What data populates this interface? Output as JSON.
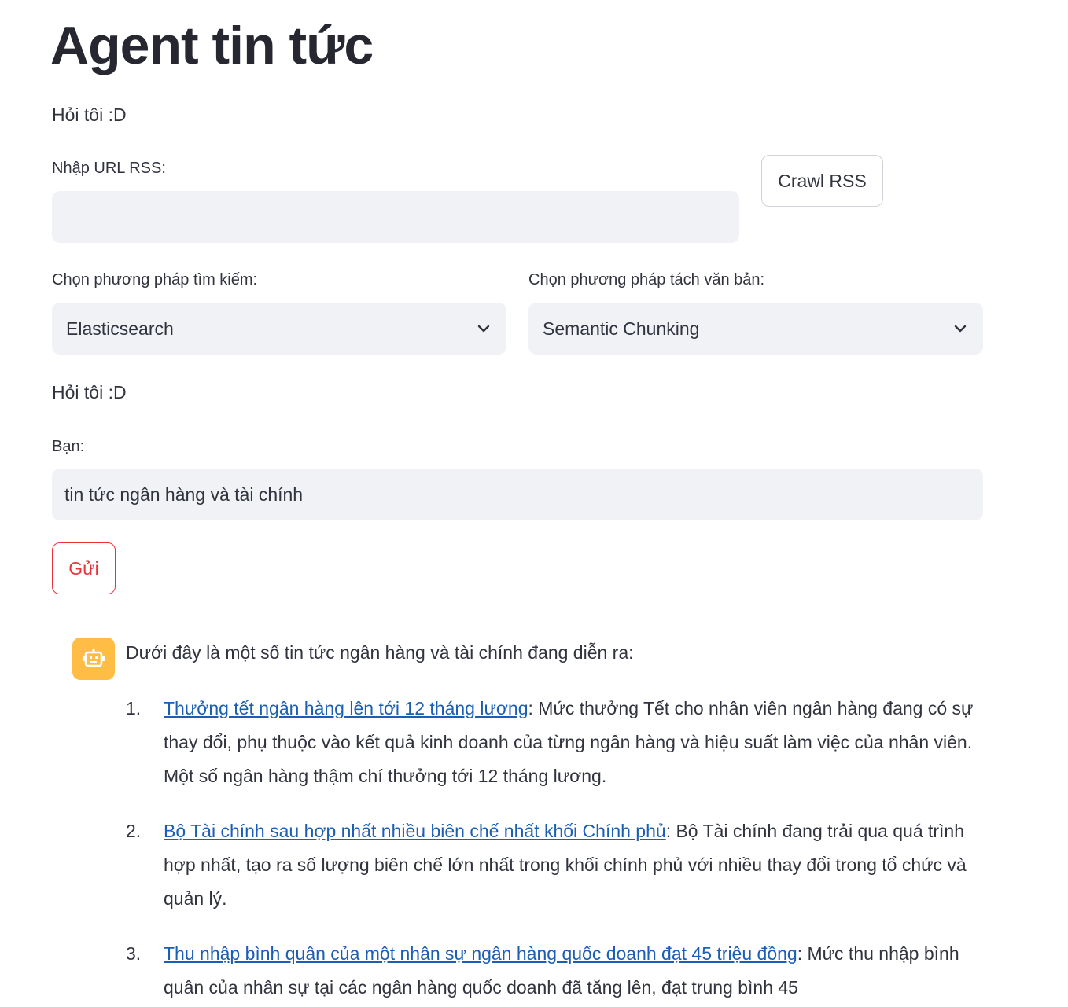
{
  "header": {
    "title": "Agent tin tức",
    "subtitle": "Hỏi tôi :D"
  },
  "rss": {
    "label": "Nhập URL RSS:",
    "value": "",
    "placeholder": "",
    "crawl_button": "Crawl RSS"
  },
  "search_method": {
    "label": "Chọn phương pháp tìm kiếm:",
    "selected": "Elasticsearch"
  },
  "split_method": {
    "label": "Chọn phương pháp tách văn bản:",
    "selected": "Semantic Chunking"
  },
  "chat": {
    "caption": "Hỏi tôi :D",
    "input_label": "Bạn:",
    "input_value": "tin tức ngân hàng và tài chính",
    "send_button": "Gửi"
  },
  "response": {
    "intro": "Dưới đây là một số tin tức ngân hàng và tài chính đang diễn ra:",
    "items": [
      {
        "number": "1.",
        "link": "Thưởng tết ngân hàng lên tới 12 tháng lương",
        "text": ": Mức thưởng Tết cho nhân viên ngân hàng đang có sự thay đổi, phụ thuộc vào kết quả kinh doanh của từng ngân hàng và hiệu suất làm việc của nhân viên. Một số ngân hàng thậm chí thưởng tới 12 tháng lương."
      },
      {
        "number": "2.",
        "link": "Bộ Tài chính sau hợp nhất nhiều biên chế nhất khối Chính phủ",
        "text": ": Bộ Tài chính đang trải qua quá trình hợp nhất, tạo ra số lượng biên chế lớn nhất trong khối chính phủ với nhiều thay đổi trong tổ chức và quản lý."
      },
      {
        "number": "3.",
        "link": "Thu nhập bình quân của một nhân sự ngân hàng quốc doanh đạt 45 triệu đồng",
        "text": ": Mức thu nhập bình quân của nhân sự tại các ngân hàng quốc doanh đã tăng lên, đạt trung bình 45"
      }
    ]
  },
  "colors": {
    "accent": "#e8333b",
    "link": "#1a5fb4",
    "avatar": "#ffbd45",
    "input_bg": "#f0f2f6"
  },
  "icons": {
    "bot_avatar": "robot-icon",
    "select_chevron": "chevron-down-icon"
  }
}
